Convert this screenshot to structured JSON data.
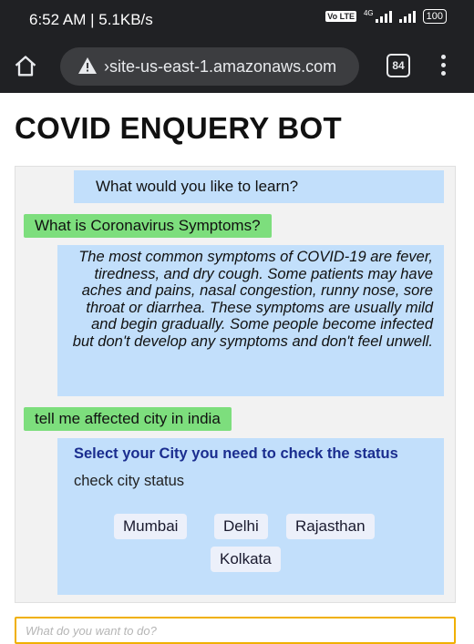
{
  "status_bar": {
    "time": "6:52 AM | 5.1KB/s",
    "volte": "Vo LTE",
    "network": "4G",
    "battery": "100"
  },
  "browser": {
    "url": "›site-us-east-1.amazonaws.com",
    "tab_count": "84",
    "icons": [
      "home-icon",
      "warning-icon",
      "menu-icon"
    ]
  },
  "page": {
    "title": "COVID ENQUERY BOT"
  },
  "chat": {
    "messages": [
      {
        "from": "bot",
        "text": "What would you like to learn?"
      },
      {
        "from": "user",
        "text": "What is Coronavirus Symptoms?"
      },
      {
        "from": "bot",
        "text": "The most common symptoms of COVID-19 are fever, tiredness, and dry cough. Some patients may have aches and pains, nasal congestion, runny nose, sore throat or diarrhea. These symptoms are usually mild and begin gradually. Some people become infected but don't develop any symptoms and don't feel unwell."
      },
      {
        "from": "user",
        "text": "tell me affected city in india"
      }
    ],
    "city_card": {
      "title": "Select your City you need to check the status",
      "subtitle": "check city status",
      "cities": [
        "Mumbai",
        "Delhi",
        "Rajasthan",
        "Kolkata"
      ]
    }
  },
  "input": {
    "placeholder": "What do you want to do?",
    "value": ""
  },
  "colors": {
    "bot_bubble": "#c2dffb",
    "user_bubble": "#7dde7d",
    "card_title": "#1a2d8f",
    "input_border": "#f0b000",
    "browser_bar": "#202124"
  }
}
